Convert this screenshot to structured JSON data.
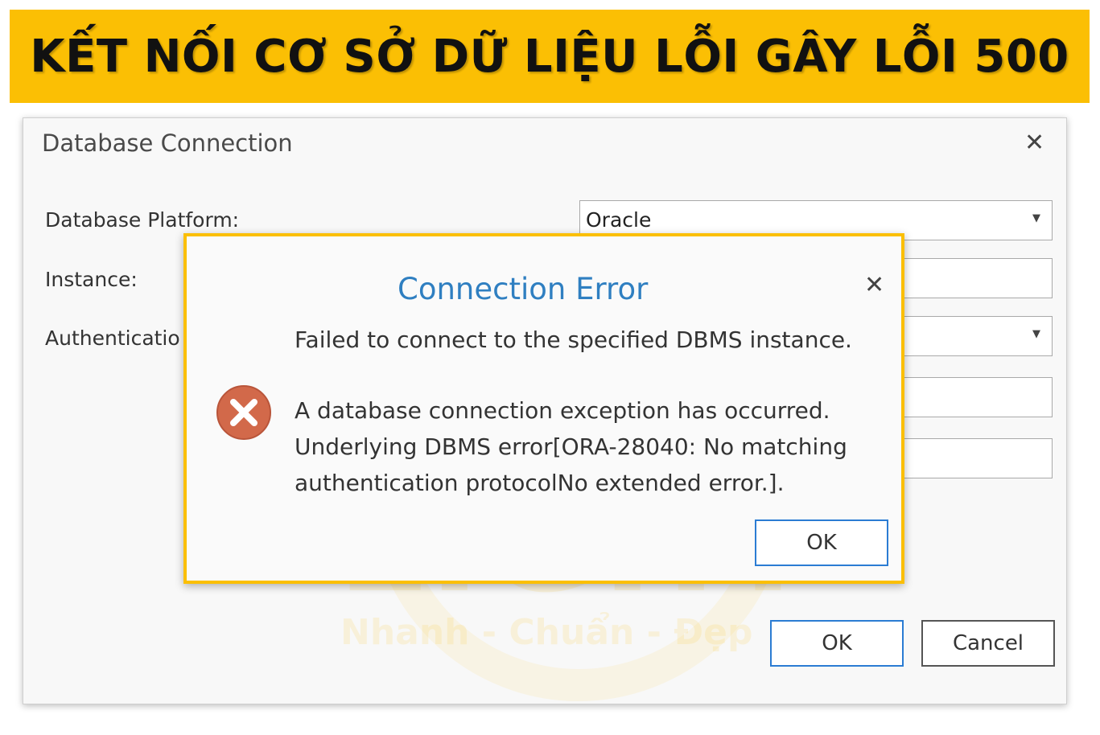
{
  "banner": {
    "title": "KẾT NỐI CƠ SỞ DỮ LIỆU LỖI GÂY LỖI 500"
  },
  "main_dialog": {
    "title": "Database Connection",
    "fields": {
      "platform_label": "Database Platform:",
      "platform_value": "Oracle",
      "instance_label": "Instance:",
      "auth_label": "Authenticatio"
    },
    "ok_label": "OK",
    "cancel_label": "Cancel"
  },
  "watermark": {
    "brand": "LIGHT",
    "tagline": "Nhanh - Chuẩn - Đẹp"
  },
  "error_dialog": {
    "title": "Connection Error",
    "message_1": "Failed to connect to the specified DBMS instance.",
    "message_2": "A database connection exception has occurred.",
    "message_3": "Underlying DBMS error[ORA-28040: No matching",
    "message_4": "authentication protocolNo extended error.].",
    "ok_label": "OK"
  },
  "icons": {
    "close": "close-icon",
    "dropdown": "chevron-down-icon",
    "error": "error-icon"
  },
  "colors": {
    "banner": "#fbbf04",
    "error_title": "#2f7fc1",
    "error_icon": "#d2694a",
    "primary_button_border": "#2b7cd3"
  }
}
